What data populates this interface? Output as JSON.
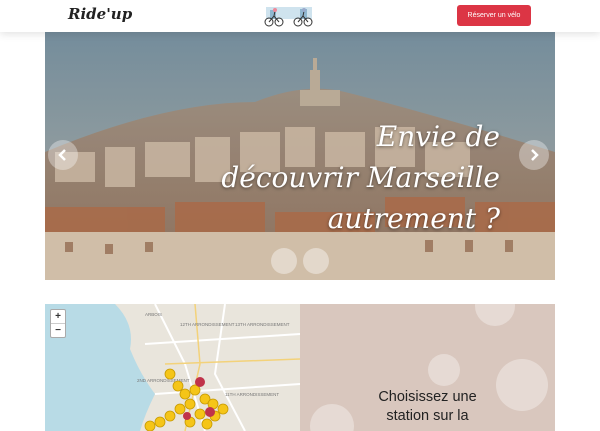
{
  "header": {
    "logo": "Ride'up",
    "reserve_label": "Réserver un vélo"
  },
  "hero": {
    "headline_lines": [
      "Envie de",
      "découvrir Marseille",
      "autrement ?"
    ],
    "prev_icon": "chevron-left-icon",
    "next_icon": "chevron-right-icon"
  },
  "map": {
    "zoom_in": "+",
    "zoom_out": "−",
    "labels": [
      "ARBOIS",
      "12TH ARRONDISSEMENT",
      "13TH ARRONDISSEMENT",
      "2ND ARRONDISSEMENT",
      "11TH ARRONDISSEMENT"
    ]
  },
  "panel": {
    "lines": [
      "Choisissez une",
      "station sur la"
    ]
  },
  "colors": {
    "accent": "#dc3545",
    "panel": "#d9c7be",
    "marker": "#f5c518"
  }
}
